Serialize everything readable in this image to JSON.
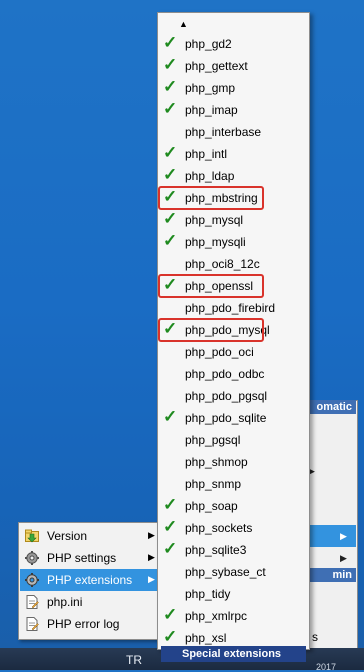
{
  "taskbar": {
    "text": "TR",
    "year": "2017"
  },
  "background_menu": {
    "header": "omatic",
    "highlight_label": "min",
    "partial_label": "s"
  },
  "left_menu": {
    "items": [
      {
        "label": "Version",
        "icon": "version-icon",
        "has_submenu": true,
        "highlighted": false
      },
      {
        "label": "PHP settings",
        "icon": "gear-icon",
        "has_submenu": true,
        "highlighted": false
      },
      {
        "label": "PHP extensions",
        "icon": "gear-icon",
        "has_submenu": true,
        "highlighted": true
      },
      {
        "label": "php.ini",
        "icon": "document-icon",
        "has_submenu": false,
        "highlighted": false
      },
      {
        "label": "PHP error log",
        "icon": "document-icon",
        "has_submenu": false,
        "highlighted": false
      }
    ]
  },
  "extensions_menu": {
    "scroll_up": "▲",
    "footer": "Special extensions",
    "items": [
      {
        "label": "php_gd2",
        "checked": true,
        "boxed": false
      },
      {
        "label": "php_gettext",
        "checked": true,
        "boxed": false
      },
      {
        "label": "php_gmp",
        "checked": true,
        "boxed": false
      },
      {
        "label": "php_imap",
        "checked": true,
        "boxed": false
      },
      {
        "label": "php_interbase",
        "checked": false,
        "boxed": false
      },
      {
        "label": "php_intl",
        "checked": true,
        "boxed": false
      },
      {
        "label": "php_ldap",
        "checked": true,
        "boxed": false
      },
      {
        "label": "php_mbstring",
        "checked": true,
        "boxed": true
      },
      {
        "label": "php_mysql",
        "checked": true,
        "boxed": false
      },
      {
        "label": "php_mysqli",
        "checked": true,
        "boxed": false
      },
      {
        "label": "php_oci8_12c",
        "checked": false,
        "boxed": false
      },
      {
        "label": "php_openssl",
        "checked": true,
        "boxed": true
      },
      {
        "label": "php_pdo_firebird",
        "checked": false,
        "boxed": false
      },
      {
        "label": "php_pdo_mysql",
        "checked": true,
        "boxed": true
      },
      {
        "label": "php_pdo_oci",
        "checked": false,
        "boxed": false
      },
      {
        "label": "php_pdo_odbc",
        "checked": false,
        "boxed": false
      },
      {
        "label": "php_pdo_pgsql",
        "checked": false,
        "boxed": false
      },
      {
        "label": "php_pdo_sqlite",
        "checked": true,
        "boxed": false
      },
      {
        "label": "php_pgsql",
        "checked": false,
        "boxed": false
      },
      {
        "label": "php_shmop",
        "checked": false,
        "boxed": false
      },
      {
        "label": "php_snmp",
        "checked": false,
        "boxed": false
      },
      {
        "label": "php_soap",
        "checked": true,
        "boxed": false
      },
      {
        "label": "php_sockets",
        "checked": true,
        "boxed": false
      },
      {
        "label": "php_sqlite3",
        "checked": true,
        "boxed": false
      },
      {
        "label": "php_sybase_ct",
        "checked": false,
        "boxed": false
      },
      {
        "label": "php_tidy",
        "checked": false,
        "boxed": false
      },
      {
        "label": "php_xmlrpc",
        "checked": true,
        "boxed": false
      },
      {
        "label": "php_xsl",
        "checked": true,
        "boxed": false
      }
    ]
  },
  "colors": {
    "highlight": "#3393df",
    "check": "#1f8a1f",
    "annotation_box": "#d9332b",
    "footer_bg": "#23438a"
  }
}
